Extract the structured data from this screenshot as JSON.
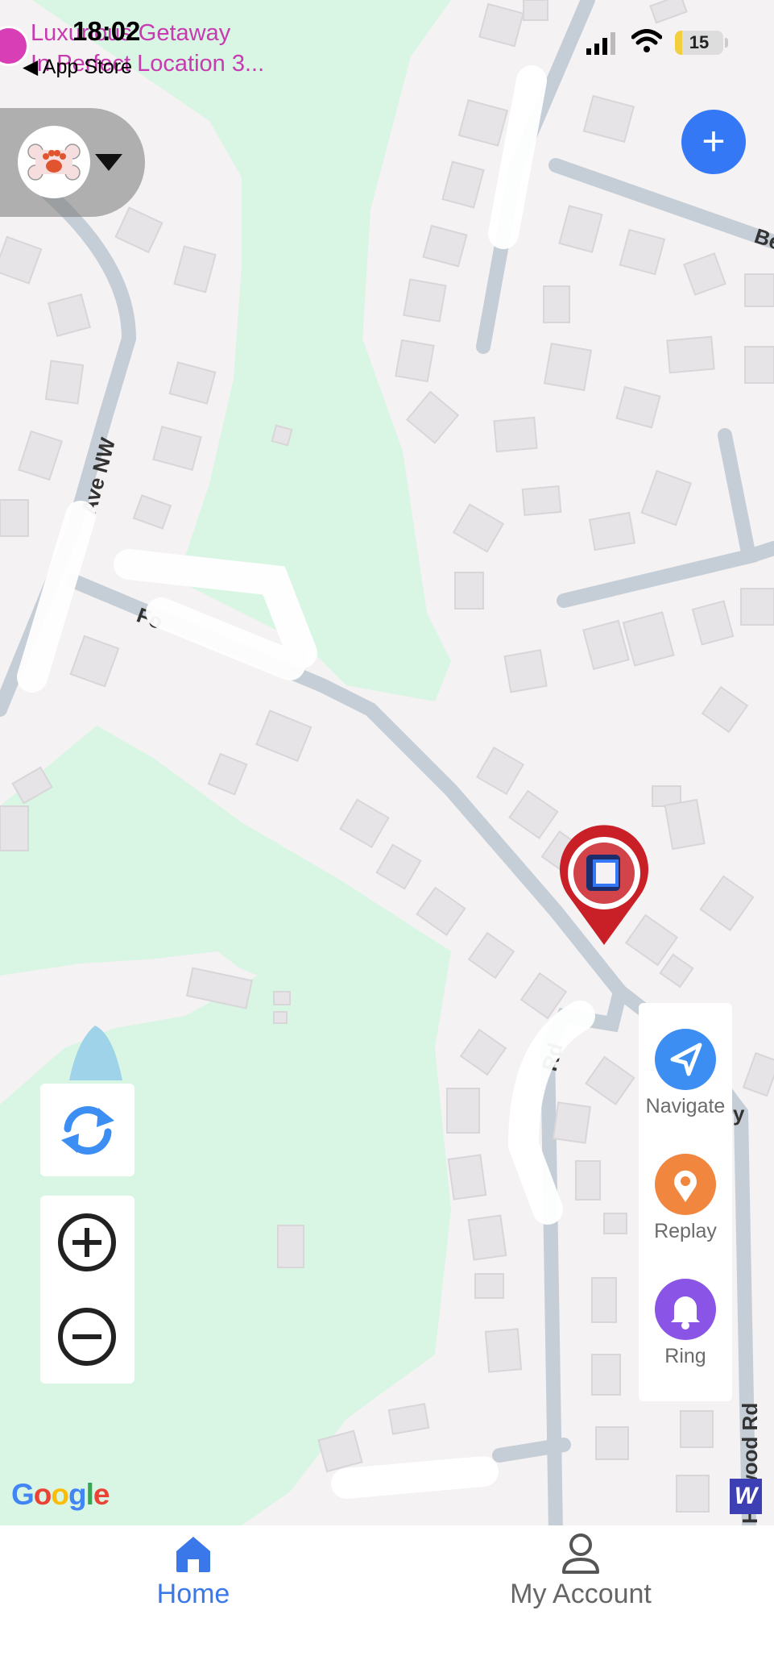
{
  "status_bar": {
    "time": "18:02",
    "back_label": "◀ App Store",
    "battery": "15",
    "battery_level": 0.15
  },
  "notification": {
    "title": "Luxurious Getaway",
    "subtitle": "In Perfect Location 3..."
  },
  "map": {
    "attribution": "Google",
    "street_labels": [
      "Ave NW",
      "Fo",
      "Be",
      "Rd",
      "Hillwood Rd",
      "y"
    ],
    "colors": {
      "park": "#d9f5e3",
      "land": "#f4f2f3",
      "road": "#c5ced6",
      "building": "#e6e4e6",
      "water": "#9fd3ea"
    }
  },
  "pet_selector": {
    "icon": "paw-bone-icon"
  },
  "actions": [
    {
      "label": "Navigate",
      "icon": "navigate-icon",
      "color": "#3d8ef3"
    },
    {
      "label": "Replay",
      "icon": "location-pin-icon",
      "color": "#f1863e"
    },
    {
      "label": "Ring",
      "icon": "bell-icon",
      "color": "#8a55e6"
    }
  ],
  "tabs": [
    {
      "label": "Home",
      "icon": "home-icon",
      "active": true
    },
    {
      "label": "My Account",
      "icon": "account-icon",
      "active": false
    }
  ]
}
